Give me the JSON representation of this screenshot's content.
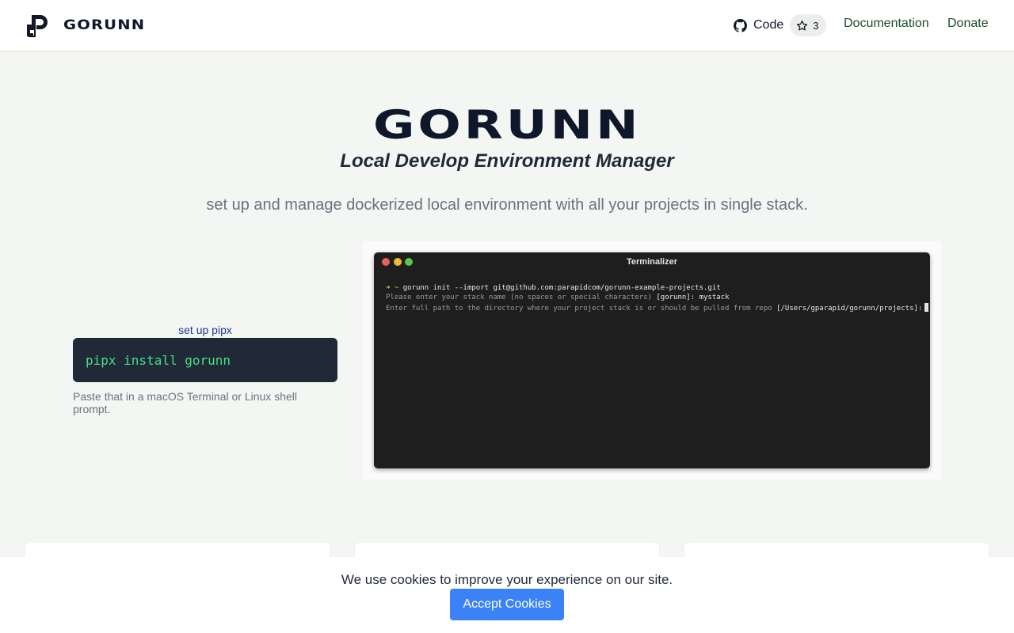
{
  "header": {
    "brand_name": "GORUNN",
    "code_label": "Code",
    "star_count": "3",
    "nav_documentation": "Documentation",
    "nav_donate": "Donate"
  },
  "hero": {
    "title": "GORUNN",
    "subtitle": "Local Develop Environment Manager",
    "tagline": "set up and manage dockerized local environment with all your projects in single stack."
  },
  "install": {
    "setup_link": "set up pipx",
    "command": "pipx install gorunn",
    "hint": "Paste that in a macOS Terminal or Linux shell prompt."
  },
  "terminal": {
    "title": "Terminalizer",
    "line1_prompt": "➜  ~",
    "line1_command": "gorunn init --import git@github.com:parapidcom/gorunn-example-projects.git",
    "line2_prompt": "Please enter your stack name (no spaces or special characters)",
    "line2_default": "[gorunn]:",
    "line2_answer": "mystack",
    "line3_prompt": "Enter full path to the directory where your project stack is or should be pulled from repo",
    "line3_default": "[/Users/gparapid/gorunn/projects]:"
  },
  "cookie": {
    "message": "We use cookies to improve your experience on our site.",
    "accept_label": "Accept Cookies"
  },
  "colors": {
    "accent_blue": "#3b82f6",
    "code_green": "#4ade80",
    "nav_green": "#1a4d2e",
    "page_background": "#f4f6f3"
  },
  "icons": [
    "brand-logo-icon",
    "github-icon",
    "star-icon"
  ]
}
